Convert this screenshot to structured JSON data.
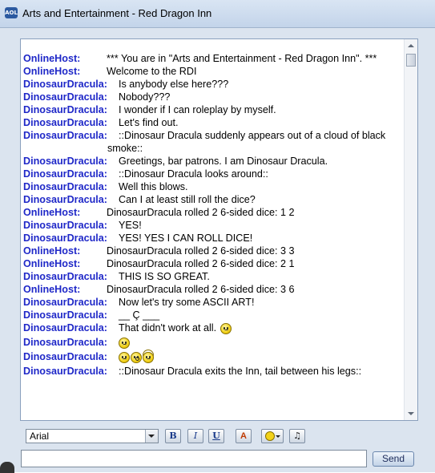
{
  "window": {
    "title": "Arts and Entertainment - Red Dragon Inn",
    "icon_label": "AOL"
  },
  "chat": {
    "messages": [
      {
        "sender": "OnlineHost:",
        "text": "*** You are in \"Arts and Entertainment - Red Dragon Inn\". ***",
        "kind": "host"
      },
      {
        "sender": "OnlineHost:",
        "text": "Welcome to the RDI",
        "kind": "host"
      },
      {
        "sender": "DinosaurDracula:",
        "text": "Is anybody else here???",
        "kind": "dd"
      },
      {
        "sender": "DinosaurDracula:",
        "text": "Nobody???",
        "kind": "dd"
      },
      {
        "sender": "DinosaurDracula:",
        "text": "I wonder if I can roleplay by myself.",
        "kind": "dd"
      },
      {
        "sender": "DinosaurDracula:",
        "text": "Let's find out.",
        "kind": "dd"
      },
      {
        "sender": "DinosaurDracula:",
        "text": "::Dinosaur Dracula suddenly appears out of a cloud of black",
        "kind": "dd"
      },
      {
        "sender": "",
        "text": "smoke::",
        "kind": "wrap"
      },
      {
        "sender": "DinosaurDracula:",
        "text": "Greetings, bar patrons. I am Dinosaur Dracula.",
        "kind": "dd"
      },
      {
        "sender": "DinosaurDracula:",
        "text": "::Dinosaur Dracula looks around::",
        "kind": "dd"
      },
      {
        "sender": "DinosaurDracula:",
        "text": "Well this blows.",
        "kind": "dd"
      },
      {
        "sender": "DinosaurDracula:",
        "text": "Can I at least still roll the dice?",
        "kind": "dd"
      },
      {
        "sender": "OnlineHost:",
        "text": "DinosaurDracula rolled 2 6-sided dice:  1 2",
        "kind": "host"
      },
      {
        "sender": "DinosaurDracula:",
        "text": "YES!",
        "kind": "dd"
      },
      {
        "sender": "DinosaurDracula:",
        "text": "YES! YES I CAN ROLL DICE!",
        "kind": "dd"
      },
      {
        "sender": "OnlineHost:",
        "text": "DinosaurDracula rolled 2 6-sided dice:  3 3",
        "kind": "host"
      },
      {
        "sender": "OnlineHost:",
        "text": "DinosaurDracula rolled 2 6-sided dice:  2 1",
        "kind": "host"
      },
      {
        "sender": "DinosaurDracula:",
        "text": "THIS IS SO GREAT.",
        "kind": "dd"
      },
      {
        "sender": "OnlineHost:",
        "text": "DinosaurDracula rolled 2 6-sided dice:  3 6",
        "kind": "host"
      },
      {
        "sender": "DinosaurDracula:",
        "text": "Now let's try some ASCII ART!",
        "kind": "dd"
      },
      {
        "sender": "DinosaurDracula:",
        "text": "__   Ç ___",
        "kind": "dd"
      },
      {
        "sender": "DinosaurDracula:",
        "text": "That didn't work at all.",
        "kind": "dd",
        "emoticons": [
          "frown"
        ]
      },
      {
        "sender": "DinosaurDracula:",
        "text": "",
        "kind": "dd",
        "emoticons": [
          "frown"
        ]
      },
      {
        "sender": "DinosaurDracula:",
        "text": "",
        "kind": "dd",
        "emoticons": [
          "frown",
          "surprise",
          "halo"
        ]
      },
      {
        "sender": "DinosaurDracula:",
        "text": "::Dinosaur Dracula exits the Inn, tail between his legs::",
        "kind": "dd"
      }
    ]
  },
  "toolbar": {
    "font_value": "Arial",
    "bold_label": "B",
    "italic_label": "I",
    "underline_label": "U",
    "color_label": "A",
    "emoticon_icon": "smiley-icon",
    "sound_icon": "music-note-icon",
    "note_glyph": "♫"
  },
  "input": {
    "value": "",
    "send_label": "Send"
  },
  "colors": {
    "sender_color": "#1f28c8",
    "frame_bg": "#dbe4ef"
  }
}
